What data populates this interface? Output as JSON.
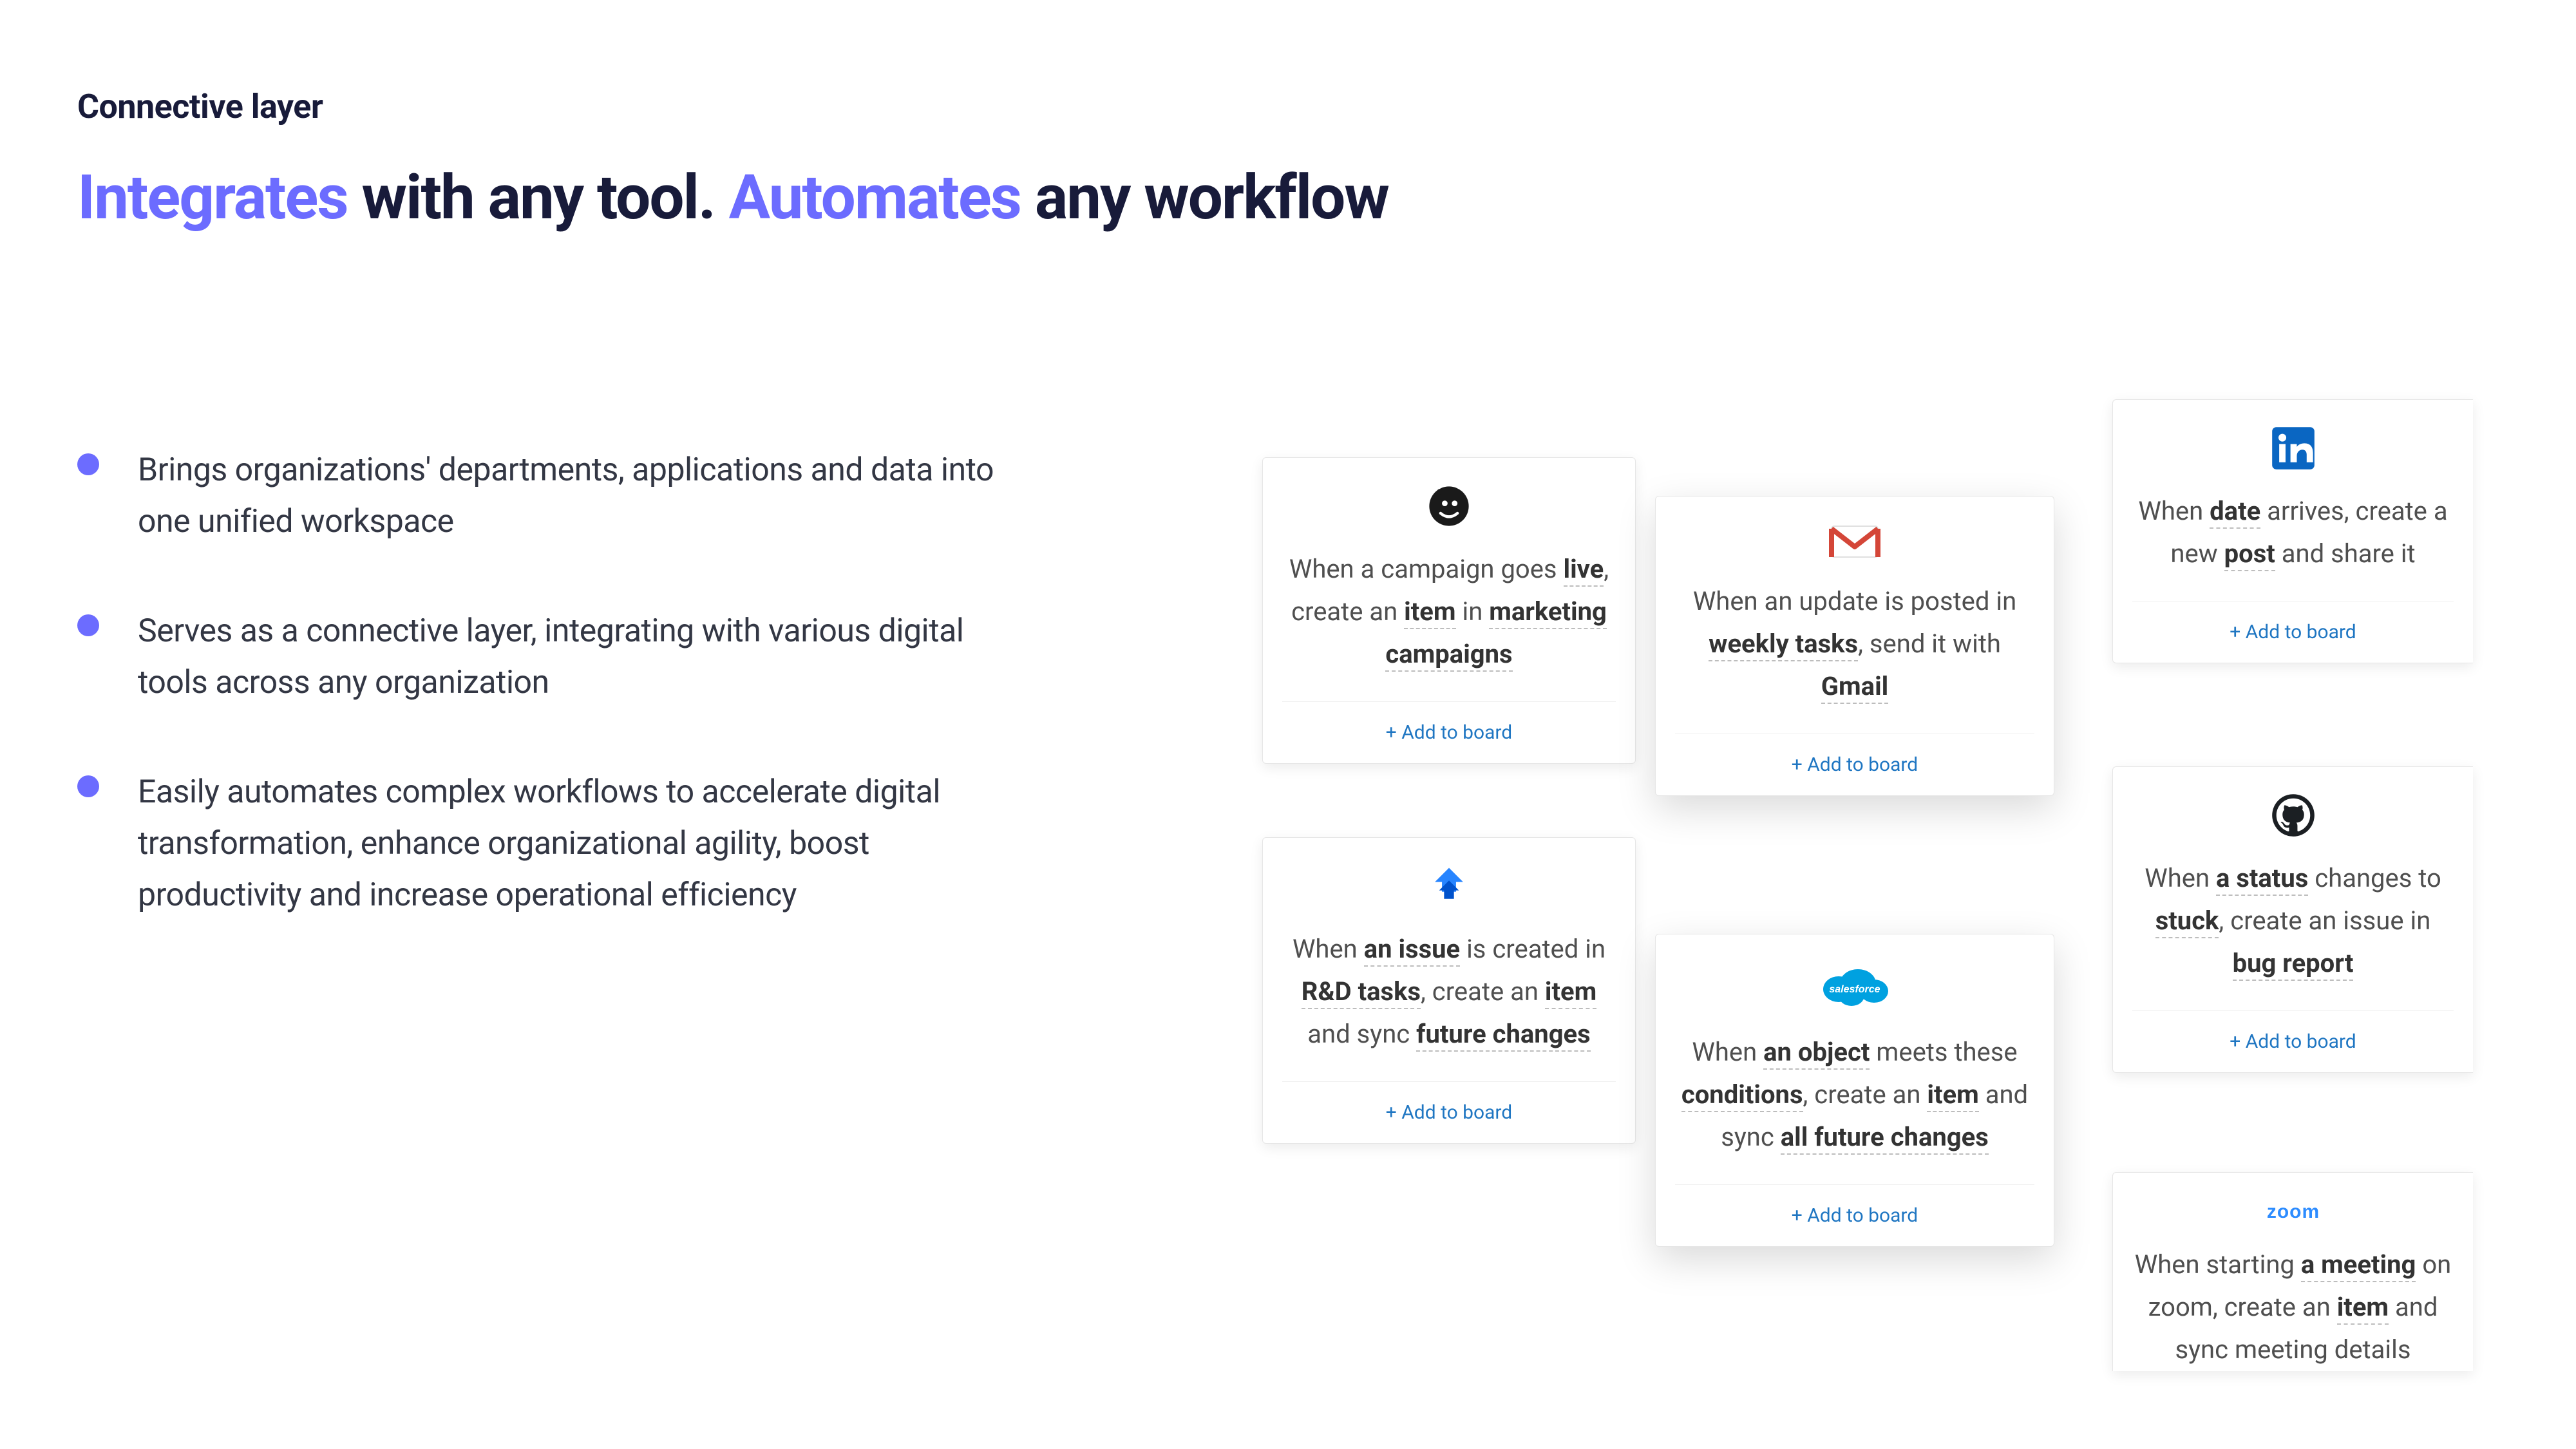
{
  "eyebrow": "Connective layer",
  "headline": {
    "part1_accent": "Integrates",
    "part2": " with any tool. ",
    "part3_accent": "Automates",
    "part4": " any workflow"
  },
  "bullets": [
    "Brings organizations' departments, applications and data into one unified workspace",
    "Serves as a connective layer, integrating with various digital tools across any organization",
    "Easily automates complex workflows to accelerate digital transformation, enhance organizational agility, boost productivity and increase operational efficiency"
  ],
  "add_to_board_label": "+ Add to board",
  "cards": {
    "mailchimp": {
      "icon_name": "mailchimp-icon",
      "segments": [
        "When a campaign goes ",
        "live",
        ", create an ",
        "item",
        " in ",
        "marketing campaigns"
      ],
      "bold_indexes": [
        1,
        3,
        5
      ]
    },
    "gmail": {
      "icon_name": "gmail-icon",
      "segments": [
        "When an update is posted in ",
        "weekly tasks",
        ", send it with ",
        "Gmail"
      ],
      "bold_indexes": [
        1,
        3
      ]
    },
    "linkedin": {
      "icon_name": "linkedin-icon",
      "segments": [
        "When ",
        "date",
        " arrives, create a new ",
        "post",
        " and share it"
      ],
      "bold_indexes": [
        1,
        3
      ]
    },
    "jira": {
      "icon_name": "jira-icon",
      "segments": [
        "When ",
        "an issue",
        " is created in ",
        "R&D tasks",
        ", create an ",
        "item",
        " and sync ",
        "future changes"
      ],
      "bold_indexes": [
        1,
        3,
        5,
        7
      ]
    },
    "salesforce": {
      "icon_name": "salesforce-icon",
      "segments": [
        "When ",
        "an object",
        " meets these ",
        "conditions",
        ", create an ",
        "item",
        " and sync ",
        "all future changes"
      ],
      "bold_indexes": [
        1,
        3,
        5,
        7
      ]
    },
    "github": {
      "icon_name": "github-icon",
      "segments": [
        "When ",
        "a status",
        " changes to ",
        "stuck",
        ", create an issue in ",
        "bug report"
      ],
      "bold_indexes": [
        1,
        3,
        5
      ]
    },
    "zoom": {
      "icon_name": "zoom-icon",
      "segments": [
        "When starting ",
        "a meeting",
        " on zoom, create an ",
        "item",
        " and sync meeting details"
      ],
      "bold_indexes": [
        1,
        3
      ]
    }
  }
}
